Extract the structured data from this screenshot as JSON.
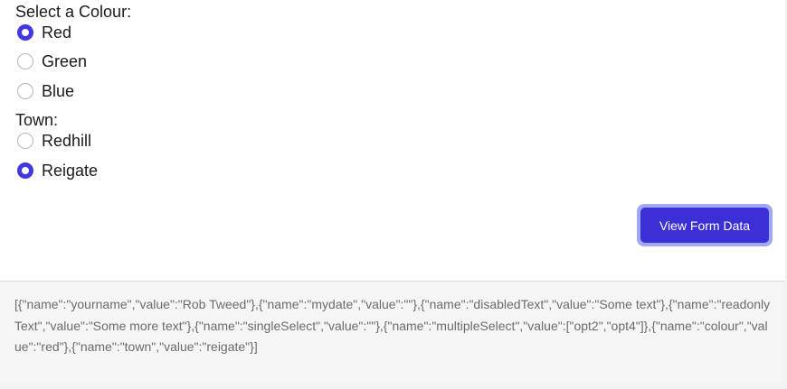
{
  "colour_group": {
    "label": "Select a Colour:",
    "options": [
      {
        "label": "Red",
        "checked": true
      },
      {
        "label": "Green",
        "checked": false
      },
      {
        "label": "Blue",
        "checked": false
      }
    ]
  },
  "town_group": {
    "label": "Town:",
    "options": [
      {
        "label": "Redhill",
        "checked": false
      },
      {
        "label": "Reigate",
        "checked": true
      }
    ]
  },
  "view_button": {
    "label": "View Form Data"
  },
  "output": {
    "text": "[{\"name\":\"yourname\",\"value\":\"Rob Tweed\"},{\"name\":\"mydate\",\"value\":\"\"},{\"name\":\"disabledText\",\"value\":\"Some text\"},{\"name\":\"readonlyText\",\"value\":\"Some more text\"},{\"name\":\"singleSelect\",\"value\":\"\"},{\"name\":\"multipleSelect\",\"value\":[\"opt2\",\"opt4\"]},{\"name\":\"colour\",\"value\":\"red\"},{\"name\":\"town\",\"value\":\"reigate\"}]"
  },
  "colors": {
    "accent": "#4338e0",
    "button": "#3b2fd6",
    "button_ring": "#9fa8f0"
  }
}
